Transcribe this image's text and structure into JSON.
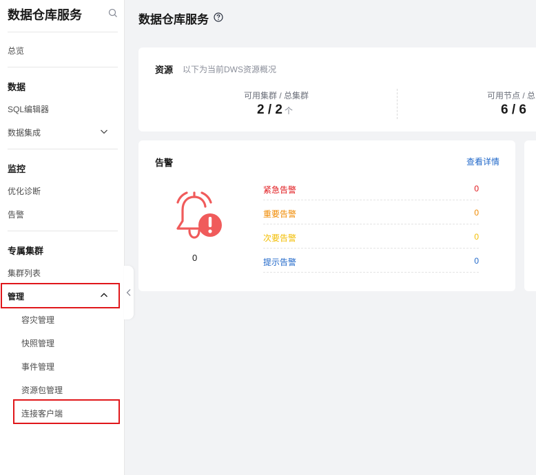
{
  "sidebar": {
    "title": "数据仓库服务",
    "overview": "总览",
    "group_data": "数据",
    "sql_editor": "SQL编辑器",
    "data_integration": "数据集成",
    "group_monitor": "监控",
    "optimize": "优化诊断",
    "alarm": "告警",
    "group_dedicated": "专属集群",
    "cluster_list": "集群列表",
    "manage": "管理",
    "sub": {
      "dr": "容灾管理",
      "snapshot": "快照管理",
      "event": "事件管理",
      "package": "资源包管理",
      "connect": "连接客户端"
    }
  },
  "main": {
    "title": "数据仓库服务"
  },
  "resources": {
    "title": "资源",
    "desc": "以下为当前DWS资源概况",
    "clusters_label": "可用集群 / 总集群",
    "clusters_value": "2 / 2",
    "clusters_unit": "个",
    "nodes_label": "可用节点 / 总",
    "nodes_value": "6 / 6"
  },
  "alarms": {
    "title": "告警",
    "link": "查看详情",
    "total": "0",
    "rows": [
      {
        "name": "紧急告警",
        "value": "0",
        "color": "#e0161a"
      },
      {
        "name": "重要告警",
        "value": "0",
        "color": "#f08a00"
      },
      {
        "name": "次要告警",
        "value": "0",
        "color": "#f2bd00"
      },
      {
        "name": "提示告警",
        "value": "0",
        "color": "#1f67c9"
      }
    ]
  },
  "colors": {
    "highlight": "#e0161a",
    "bell": "#f05b5b",
    "link": "#1f67c9"
  }
}
